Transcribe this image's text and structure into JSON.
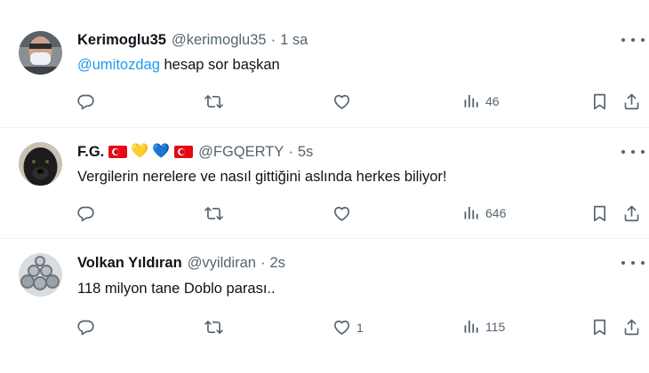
{
  "tweets": [
    {
      "name": "Kerimoglu35",
      "handle": "@kerimoglu35",
      "separator": "·",
      "time": "1 sa",
      "mention": "@umitozdag",
      "text": " hesap sor başkan",
      "views": "46",
      "likes": "",
      "avatar_icon": "masked-person-avatar"
    },
    {
      "name": "F.G.",
      "handle": "@FGQERTY",
      "separator": "·",
      "time": "5s",
      "text": "Vergilerin nerelere ve nasıl gittiğini aslında herkes biliyor!",
      "views": "646",
      "likes": "",
      "name_emojis": [
        "turkish-flag",
        "yellow-heart",
        "blue-heart",
        "turkish-flag"
      ],
      "hearts": [
        "💛",
        "💙"
      ],
      "avatar_icon": "dog-avatar"
    },
    {
      "name": "Volkan Yıldıran",
      "handle": "@vyildiran",
      "separator": "·",
      "time": "2s",
      "text": "118 milyon tane Doblo parası..",
      "views": "115",
      "likes": "1",
      "avatar_icon": "steel-pipes-avatar"
    }
  ],
  "colors": {
    "accent": "#1d9bf0",
    "secondary_text": "#536471",
    "divider": "#eff3f4",
    "flag_red": "#e30a17"
  },
  "icons": [
    "reply-icon",
    "retweet-icon",
    "like-icon",
    "views-icon",
    "bookmark-icon",
    "share-icon",
    "more-icon"
  ]
}
